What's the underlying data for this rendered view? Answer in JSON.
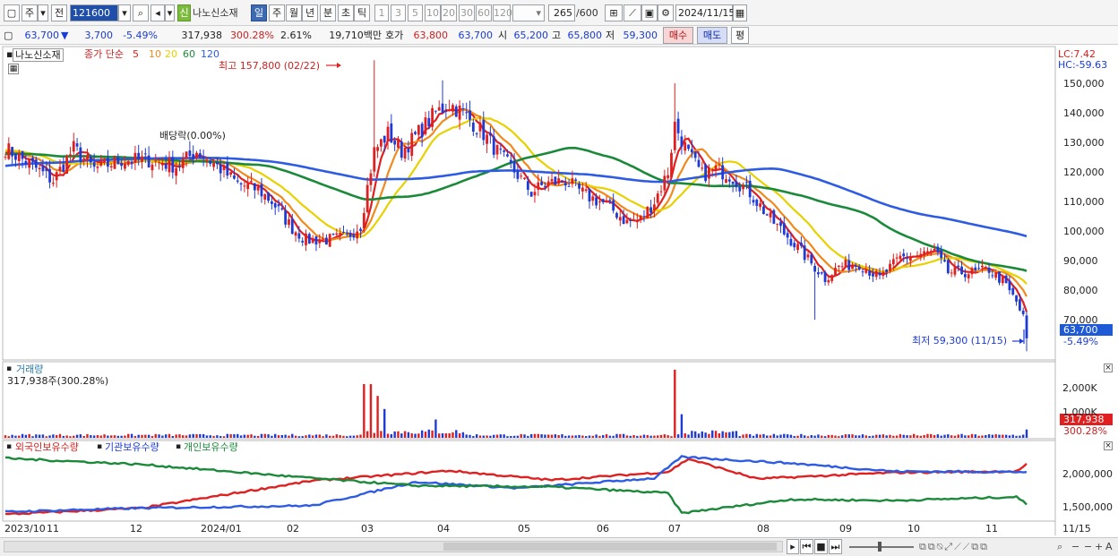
{
  "toolbar": {
    "market_tabs": [
      "주",
      "전"
    ],
    "code": "121600",
    "shin_label": "신",
    "stock_name": "나노신소재",
    "period_tabs": [
      {
        "label": "일",
        "active": true
      },
      {
        "label": "주",
        "active": false
      },
      {
        "label": "월",
        "active": false
      },
      {
        "label": "년",
        "active": false
      },
      {
        "label": "분",
        "active": false
      },
      {
        "label": "초",
        "active": false
      },
      {
        "label": "틱",
        "active": false
      }
    ],
    "interval_options": [
      "1",
      "3",
      "5",
      "10",
      "20",
      "30",
      "60",
      "120"
    ],
    "count_display": "265",
    "count_total": "/600",
    "date": "2024/11/15"
  },
  "quote": {
    "price": "63,700",
    "change_arrow": "▼",
    "change": "3,700",
    "change_pct": "-5.49%",
    "volume": "317,938",
    "volume_ratio": "300.28%",
    "turnover": "2.61%",
    "amount": "19,710백만",
    "hoga_label": "호가",
    "ask": "63,800",
    "bid": "63,700",
    "open_label": "시",
    "open": "65,200",
    "high_label": "고",
    "high": "65,800",
    "low_label": "저",
    "low": "59,300",
    "buy_label": "매수",
    "sell_label": "매도",
    "pyeong_label": "평"
  },
  "legend": {
    "stock": "나노신소재",
    "series_text": "종가 단순",
    "ma": [
      {
        "label": "5",
        "color": "#e02020"
      },
      {
        "label": "10",
        "color": "#f08a1c"
      },
      {
        "label": "20",
        "color": "#e8d100"
      },
      {
        "label": "60",
        "color": "#1a8a3a"
      },
      {
        "label": "120",
        "color": "#2d5be3"
      }
    ]
  },
  "annotations": {
    "high": "최고 157,800 (02/22)",
    "low": "최저 59,300 (11/15)",
    "dividend": "배당락(0.00%)",
    "lc": "LC:7.42",
    "hc": "HC:-59.63",
    "current_price_tag": "63,700",
    "current_pct_tag": "-5.49%"
  },
  "volume_panel": {
    "title": "거래량",
    "subtitle": "317,938주(300.28%)",
    "ticks": [
      "2,000K",
      "1,000K"
    ],
    "current_tag": "317,938",
    "current_pct": "300.28%"
  },
  "holdings_panel": {
    "legend": [
      {
        "label": "외국인보유수량",
        "color": "#e02020"
      },
      {
        "label": "기관보유수량",
        "color": "#2d5be3"
      },
      {
        "label": "개인보유수량",
        "color": "#1a8a3a"
      }
    ],
    "ticks": [
      "2,000,000",
      "1,500,000"
    ]
  },
  "x_axis": {
    "labels": [
      "2023/10",
      "11",
      "12",
      "2024/01",
      "02",
      "03",
      "04",
      "05",
      "06",
      "07",
      "08",
      "09",
      "10",
      "11"
    ],
    "right_label": "11/15"
  },
  "chart_data": {
    "type": "candlestick",
    "title": "나노신소재",
    "price_axis_ticks": [
      150000,
      140000,
      130000,
      120000,
      110000,
      100000,
      90000,
      80000,
      70000
    ],
    "price_axis_labels": [
      "150,000",
      "140,000",
      "130,000",
      "120,000",
      "110,000",
      "100,000",
      "90,000",
      "80,000",
      "70,000"
    ],
    "ylim": [
      57000,
      160000
    ],
    "points": 265,
    "close_anchors": [
      [
        0,
        128000
      ],
      [
        8,
        122000
      ],
      [
        14,
        117000
      ],
      [
        20,
        128000
      ],
      [
        26,
        121000
      ],
      [
        34,
        124000
      ],
      [
        42,
        124000
      ],
      [
        50,
        122000
      ],
      [
        56,
        127000
      ],
      [
        62,
        122000
      ],
      [
        68,
        116000
      ],
      [
        74,
        114000
      ],
      [
        78,
        110000
      ],
      [
        84,
        101000
      ],
      [
        88,
        97000
      ],
      [
        94,
        97000
      ],
      [
        100,
        98000
      ],
      [
        104,
        102000
      ],
      [
        106,
        115000
      ],
      [
        108,
        127000
      ],
      [
        112,
        133000
      ],
      [
        116,
        127000
      ],
      [
        120,
        132000
      ],
      [
        126,
        140000
      ],
      [
        130,
        143000
      ],
      [
        134,
        140000
      ],
      [
        140,
        133000
      ],
      [
        146,
        124000
      ],
      [
        150,
        119000
      ],
      [
        154,
        113000
      ],
      [
        158,
        116000
      ],
      [
        164,
        117000
      ],
      [
        170,
        112000
      ],
      [
        176,
        109000
      ],
      [
        182,
        103000
      ],
      [
        186,
        104000
      ],
      [
        190,
        110000
      ],
      [
        194,
        120000
      ],
      [
        196,
        136000
      ],
      [
        200,
        126000
      ],
      [
        204,
        119000
      ],
      [
        208,
        121000
      ],
      [
        212,
        119000
      ],
      [
        218,
        113000
      ],
      [
        224,
        104000
      ],
      [
        230,
        97000
      ],
      [
        236,
        89000
      ],
      [
        240,
        84000
      ],
      [
        244,
        88000
      ],
      [
        250,
        89000
      ],
      [
        256,
        84000
      ],
      [
        262,
        91000
      ],
      [
        268,
        92000
      ],
      [
        272,
        93000
      ],
      [
        276,
        86000
      ],
      [
        280,
        86000
      ],
      [
        284,
        86000
      ],
      [
        288,
        87000
      ],
      [
        292,
        83000
      ],
      [
        296,
        76000
      ],
      [
        299,
        68000
      ]
    ],
    "highlights": {
      "high": 157800,
      "high_date": "02/22",
      "low": 59300,
      "low_date": "11/15",
      "last": 63700
    },
    "moving_averages": [
      {
        "period": 5,
        "color": "#e02020"
      },
      {
        "period": 10,
        "color": "#f08a1c"
      },
      {
        "period": 20,
        "color": "#e8d100"
      },
      {
        "period": 60,
        "color": "#1a8a3a"
      },
      {
        "period": 120,
        "color": "#2d5be3"
      }
    ],
    "volume": {
      "unit": "shares",
      "ylim": [
        0,
        2700000
      ],
      "spikes": [
        {
          "at_price_index": 105,
          "value": 2050000
        },
        {
          "at_price_index": 107,
          "value": 2050000
        },
        {
          "at_price_index": 109,
          "value": 1600000
        },
        {
          "at_price_index": 111,
          "value": 1100000
        },
        {
          "at_price_index": 196,
          "value": 2600000
        },
        {
          "at_price_index": 198,
          "value": 900000
        },
        {
          "at_price_index": 126,
          "value": 700000
        }
      ],
      "last": 317938
    },
    "holdings": {
      "ylim": [
        1300000,
        2450000
      ],
      "foreign_anchors": [
        [
          0,
          1380000
        ],
        [
          40,
          1480000
        ],
        [
          90,
          1920000
        ],
        [
          130,
          2080000
        ],
        [
          160,
          1930000
        ],
        [
          194,
          2060000
        ],
        [
          200,
          2270000
        ],
        [
          220,
          1950000
        ],
        [
          260,
          2050000
        ],
        [
          296,
          2070000
        ],
        [
          299,
          2180000
        ]
      ],
      "institution_anchors": [
        [
          0,
          1420000
        ],
        [
          40,
          1480000
        ],
        [
          90,
          1520000
        ],
        [
          120,
          1900000
        ],
        [
          150,
          1800000
        ],
        [
          190,
          1960000
        ],
        [
          198,
          2300000
        ],
        [
          230,
          2200000
        ],
        [
          260,
          2070000
        ],
        [
          299,
          2060000
        ]
      ],
      "individual_anchors": [
        [
          0,
          2280000
        ],
        [
          40,
          2180000
        ],
        [
          90,
          1960000
        ],
        [
          120,
          1840000
        ],
        [
          160,
          1820000
        ],
        [
          194,
          1720000
        ],
        [
          198,
          1400000
        ],
        [
          230,
          1620000
        ],
        [
          260,
          1600000
        ],
        [
          296,
          1660000
        ],
        [
          299,
          1540000
        ]
      ]
    }
  }
}
